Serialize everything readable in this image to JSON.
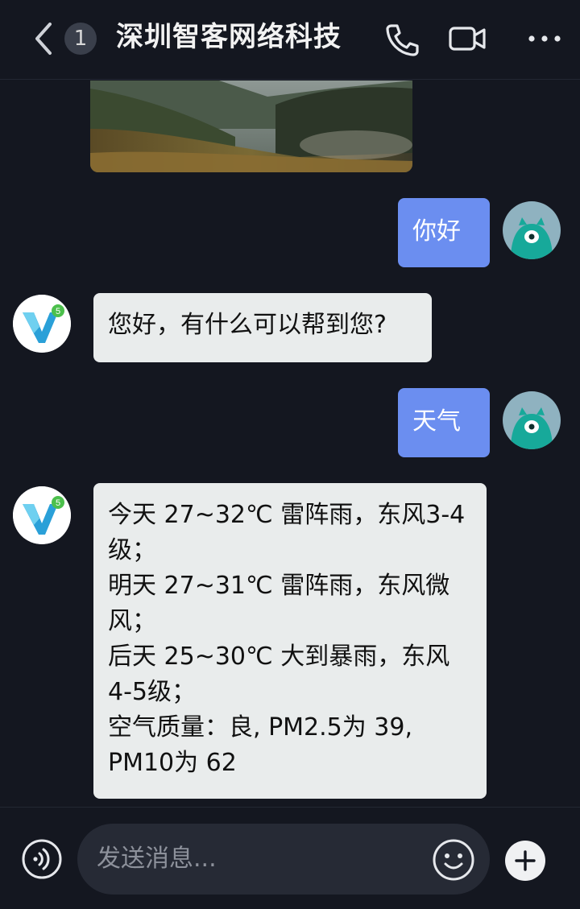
{
  "header": {
    "unread_count": "1",
    "title": "深圳智客网络科技",
    "icons": [
      "back-icon",
      "phone-icon",
      "video-call-icon",
      "more-icon"
    ]
  },
  "messages": [
    {
      "from": "me",
      "text": "你好"
    },
    {
      "from": "bot",
      "text": "您好，有什么可以帮到您?"
    },
    {
      "from": "me",
      "text": "天气"
    },
    {
      "from": "bot",
      "lines": [
        "今天 27~32℃ 雷阵雨，东风3-4",
        "级；",
        "明天 27~31℃ 雷阵雨，东风微",
        "风；",
        "后天 25~30℃ 大到暴雨，东风",
        "4-5级；",
        "空气质量：良, PM2.5为 39,",
        "PM10为 62"
      ]
    }
  ],
  "composer": {
    "placeholder": "发送消息...",
    "icons": [
      "voice-icon",
      "emoji-icon",
      "plus-icon"
    ]
  },
  "colors": {
    "background": "#141720",
    "my_bubble": "#6b8ef0",
    "bot_bubble": "#e9ecec",
    "input": "#262a35",
    "user_avatar": "#8fb2c0",
    "bot_logo": "#2aa0d8"
  }
}
